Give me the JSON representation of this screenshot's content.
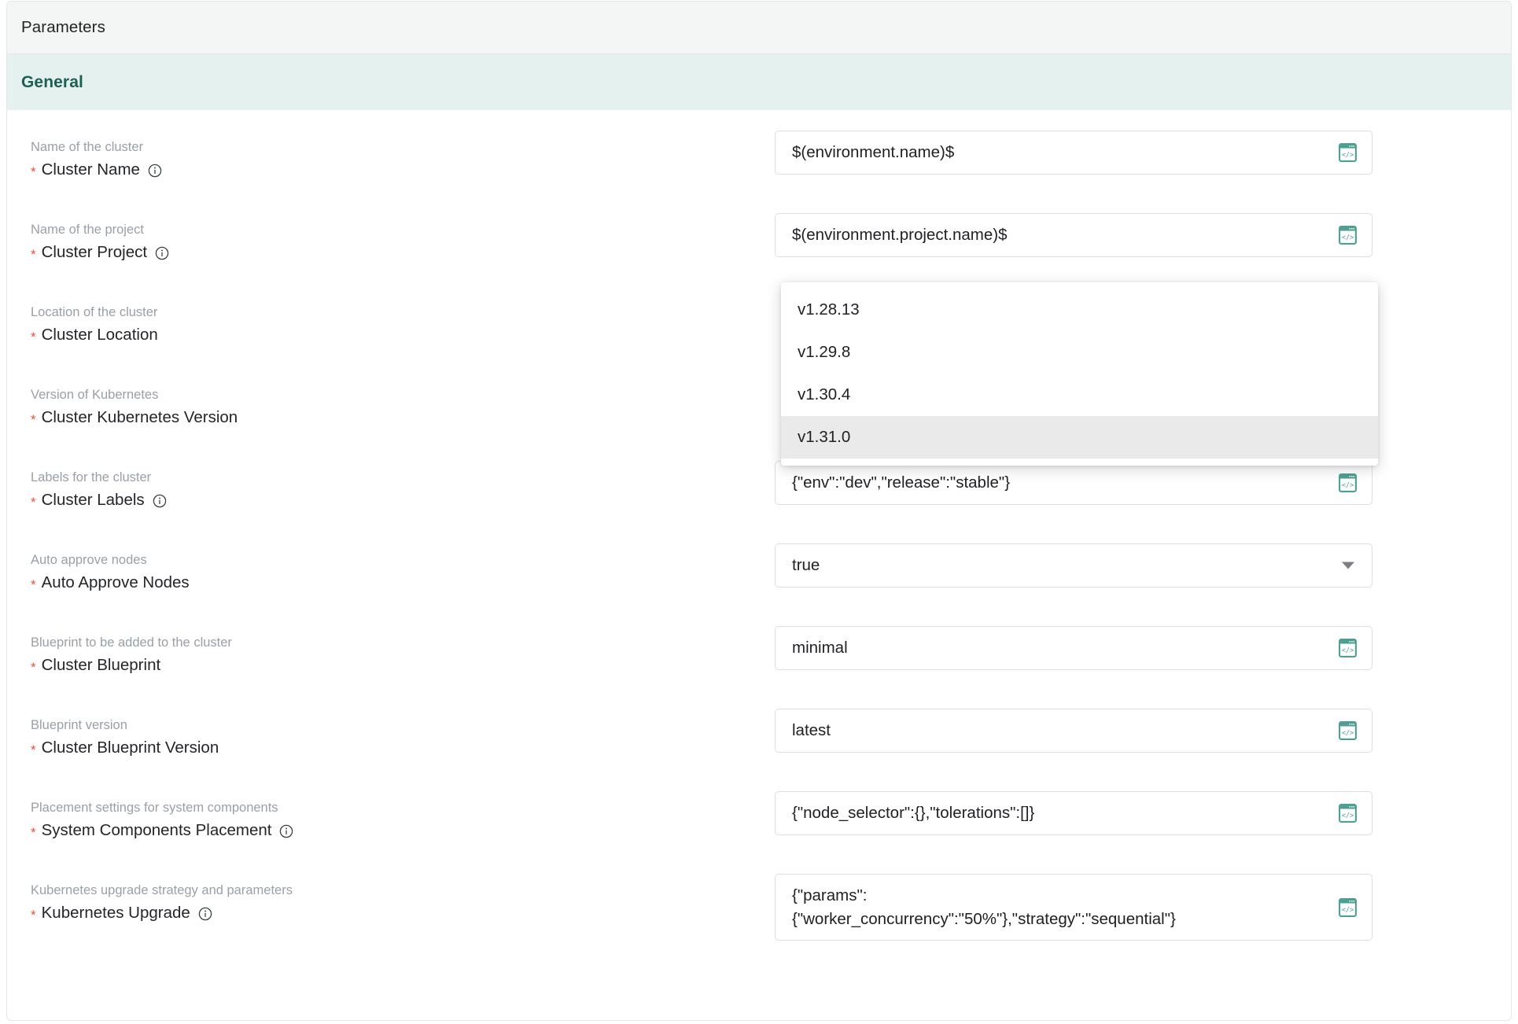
{
  "card": {
    "header_title": "Parameters",
    "section_title": "General"
  },
  "colors": {
    "section_banner_bg": "#e4f1ef",
    "section_title": "#1e5f53",
    "required_star": "#e8513a",
    "code_icon": "#4f9e93",
    "dropdown_selected_bg": "#eaeaea"
  },
  "fields": [
    {
      "description": "Name of the cluster",
      "label": "Cluster Name",
      "required_marker": "*",
      "has_info_icon": true,
      "control": "text",
      "value": "$(environment.name)$",
      "trailing_icon": "code-editor-icon"
    },
    {
      "description": "Name of the project",
      "label": "Cluster Project",
      "required_marker": "*",
      "has_info_icon": true,
      "control": "text",
      "value": "$(environment.project.name)$",
      "trailing_icon": "code-editor-icon"
    },
    {
      "description": "Location of the cluster",
      "label": "Cluster Location",
      "required_marker": "*",
      "has_info_icon": false,
      "control": "hidden",
      "value": "",
      "trailing_icon": ""
    },
    {
      "description": "Version of Kubernetes",
      "label": "Cluster Kubernetes Version",
      "required_marker": "*",
      "has_info_icon": false,
      "control": "hidden",
      "value": "",
      "trailing_icon": ""
    },
    {
      "description": "Labels for the cluster",
      "label": "Cluster Labels",
      "required_marker": "*",
      "has_info_icon": true,
      "control": "text",
      "value": "{\"env\":\"dev\",\"release\":\"stable\"}",
      "trailing_icon": "code-editor-icon"
    },
    {
      "description": "Auto approve nodes",
      "label": "Auto Approve Nodes",
      "required_marker": "*",
      "has_info_icon": false,
      "control": "select",
      "value": "true",
      "trailing_icon": "chevron-down-icon"
    },
    {
      "description": "Blueprint to be added to the cluster",
      "label": "Cluster Blueprint",
      "required_marker": "*",
      "has_info_icon": false,
      "control": "text",
      "value": "minimal",
      "trailing_icon": "code-editor-icon"
    },
    {
      "description": "Blueprint version",
      "label": "Cluster Blueprint Version",
      "required_marker": "*",
      "has_info_icon": false,
      "control": "text",
      "value": "latest",
      "trailing_icon": "code-editor-icon"
    },
    {
      "description": "Placement settings for system components",
      "label": "System Components Placement",
      "required_marker": "*",
      "has_info_icon": true,
      "control": "text",
      "value": "{\"node_selector\":{},\"tolerations\":[]}",
      "trailing_icon": "code-editor-icon"
    },
    {
      "description": "Kubernetes upgrade strategy and parameters",
      "label": "Kubernetes Upgrade",
      "required_marker": "*",
      "has_info_icon": true,
      "control": "textarea",
      "value": "{\"params\":\n{\"worker_concurrency\":\"50%\"},\"strategy\":\"sequential\"}",
      "trailing_icon": "code-editor-icon"
    }
  ],
  "open_dropdown": {
    "belongs_to_field": "Cluster Kubernetes Version",
    "options": [
      {
        "label": "v1.28.13",
        "selected": false
      },
      {
        "label": "v1.29.8",
        "selected": false
      },
      {
        "label": "v1.30.4",
        "selected": false
      },
      {
        "label": "v1.31.0",
        "selected": true
      }
    ]
  }
}
